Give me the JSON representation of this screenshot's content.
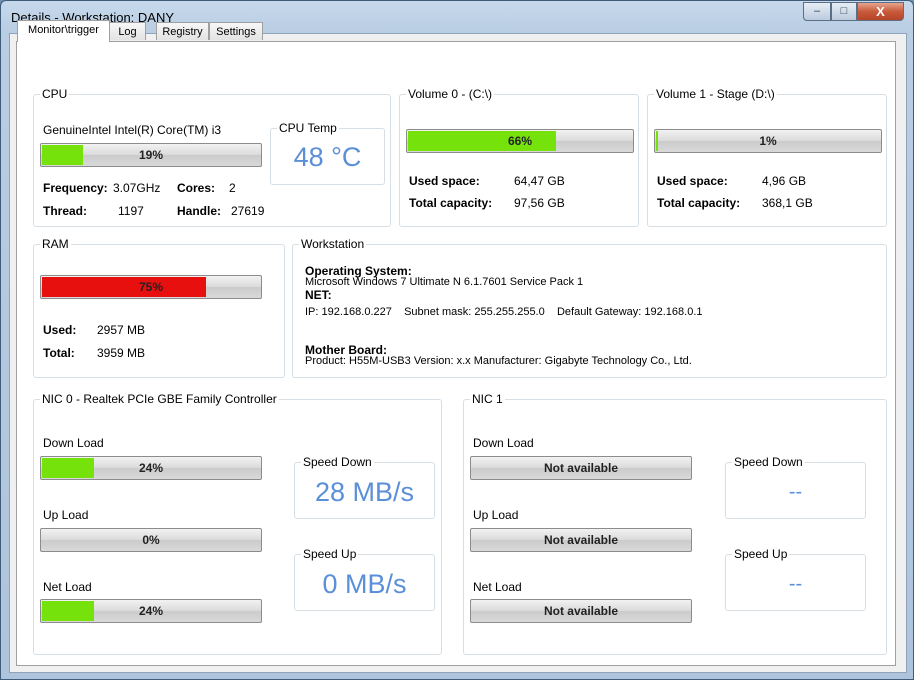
{
  "window": {
    "title": "Details - Workstation: DANY",
    "min": "–",
    "max": "□",
    "close": "X"
  },
  "tabs": [
    "Monitor\\trigger",
    "Log",
    "Registry",
    "Settings"
  ],
  "cpu": {
    "caption": "CPU",
    "name": "GenuineIntel Intel(R) Core(TM) i3",
    "usage_text": "19%",
    "usage": 0.19,
    "freq_label": "Frequency:",
    "freq": "3.07GHz",
    "cores_label": "Cores:",
    "cores": "2",
    "thread_label": "Thread:",
    "thread": "1197",
    "handle_label": "Handle:",
    "handle": "27619",
    "temp_caption": "CPU Temp",
    "temp": "48 °C"
  },
  "volume0": {
    "caption": "Volume 0 -  (C:\\)",
    "usage_text": "66%",
    "usage": 0.66,
    "used_label": "Used space:",
    "used": "64,47 GB",
    "cap_label": "Total capacity:",
    "capacity": "97,56 GB"
  },
  "volume1": {
    "caption": "Volume 1 - Stage (D:\\)",
    "usage_text": "1%",
    "usage": 0.01,
    "used_label": "Used space:",
    "used": "4,96 GB",
    "cap_label": "Total capacity:",
    "capacity": "368,1 GB"
  },
  "ram": {
    "caption": "RAM",
    "usage_text": "75%",
    "usage": 0.75,
    "used_label": "Used:",
    "used": "2957 MB",
    "total_label": "Total:",
    "total": "3959 MB"
  },
  "workstation": {
    "caption": "Workstation",
    "os_label": "Operating System:",
    "os": "Microsoft Windows 7 Ultimate N  6.1.7601 Service Pack 1",
    "net_label": "NET:",
    "net": "IP: 192.168.0.227    Subnet mask: 255.255.255.0    Default Gateway: 192.168.0.1",
    "mb_label": "Mother Board:",
    "mb": "Product: H55M-USB3 Version: x.x Manufacturer: Gigabyte Technology Co., Ltd."
  },
  "nic0": {
    "caption": "NIC 0 - Realtek PCIe GBE Family Controller",
    "down_label": "Down Load",
    "down_text": "24%",
    "down": 0.24,
    "up_label": "Up Load",
    "up_text": "0%",
    "up": 0.0,
    "net_label": "Net Load",
    "net_text": "24%",
    "net": 0.24,
    "speed_down_caption": "Speed Down",
    "speed_down": "28 MB/s",
    "speed_up_caption": "Speed Up",
    "speed_up": "0 MB/s"
  },
  "nic1": {
    "caption": "NIC 1",
    "down_label": "Down Load",
    "down_text": "Not available",
    "down": 0,
    "up_label": "Up Load",
    "up_text": "Not available",
    "up": 0,
    "net_label": "Net Load",
    "net_text": "Not available",
    "net": 0,
    "speed_down_caption": "Speed Down",
    "speed_down": "--",
    "speed_up_caption": "Speed Up",
    "speed_up": "--"
  },
  "colors": {
    "green": "#76e20c",
    "red": "#e80f0f",
    "accent_blue": "#5b8fd9"
  }
}
